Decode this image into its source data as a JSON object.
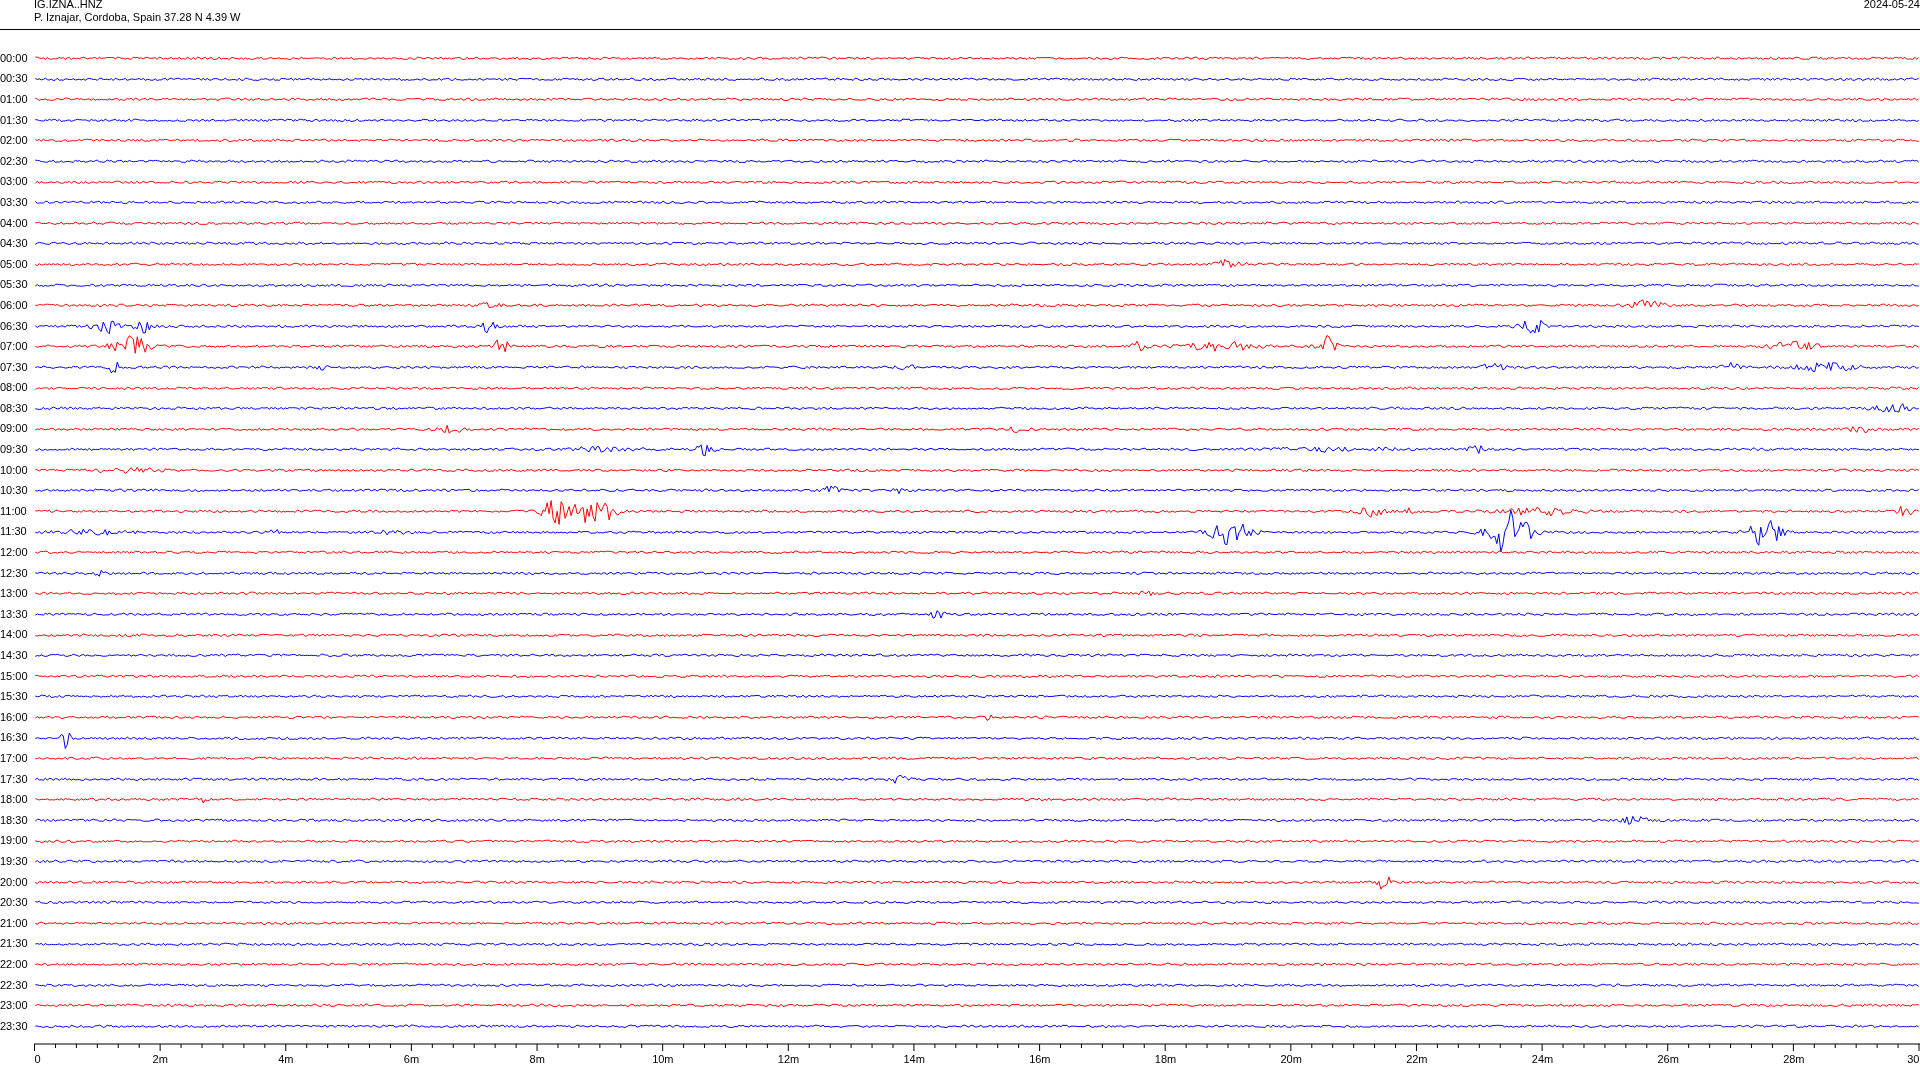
{
  "header": {
    "station": "IG.IZNA..HNZ",
    "location": "P. Iznajar, Cordoba, Spain  37.28 N 4.39 W",
    "date": "2024-05-24"
  },
  "traces": [
    {
      "label": "00:00",
      "color": "#ff0000"
    },
    {
      "label": "00:30",
      "color": "#0000ff"
    },
    {
      "label": "01:00",
      "color": "#ff0000"
    },
    {
      "label": "01:30",
      "color": "#0000ff"
    },
    {
      "label": "02:00",
      "color": "#ff0000"
    },
    {
      "label": "02:30",
      "color": "#0000ff"
    },
    {
      "label": "03:00",
      "color": "#ff0000"
    },
    {
      "label": "03:30",
      "color": "#0000ff"
    },
    {
      "label": "04:00",
      "color": "#ff0000"
    },
    {
      "label": "04:30",
      "color": "#0000ff"
    },
    {
      "label": "05:00",
      "color": "#ff0000"
    },
    {
      "label": "05:30",
      "color": "#0000ff"
    },
    {
      "label": "06:00",
      "color": "#ff0000"
    },
    {
      "label": "06:30",
      "color": "#0000ff"
    },
    {
      "label": "07:00",
      "color": "#ff0000"
    },
    {
      "label": "07:30",
      "color": "#0000ff"
    },
    {
      "label": "08:00",
      "color": "#ff0000"
    },
    {
      "label": "08:30",
      "color": "#0000ff"
    },
    {
      "label": "09:00",
      "color": "#ff0000"
    },
    {
      "label": "09:30",
      "color": "#0000ff"
    },
    {
      "label": "10:00",
      "color": "#ff0000"
    },
    {
      "label": "10:30",
      "color": "#0000ff"
    },
    {
      "label": "11:00",
      "color": "#ff0000"
    },
    {
      "label": "11:30",
      "color": "#0000ff"
    },
    {
      "label": "12:00",
      "color": "#ff0000"
    },
    {
      "label": "12:30",
      "color": "#0000ff"
    },
    {
      "label": "13:00",
      "color": "#ff0000"
    },
    {
      "label": "13:30",
      "color": "#0000ff"
    },
    {
      "label": "14:00",
      "color": "#ff0000"
    },
    {
      "label": "14:30",
      "color": "#0000ff"
    },
    {
      "label": "15:00",
      "color": "#ff0000"
    },
    {
      "label": "15:30",
      "color": "#0000ff"
    },
    {
      "label": "16:00",
      "color": "#ff0000"
    },
    {
      "label": "16:30",
      "color": "#0000ff"
    },
    {
      "label": "17:00",
      "color": "#ff0000"
    },
    {
      "label": "17:30",
      "color": "#0000ff"
    },
    {
      "label": "18:00",
      "color": "#ff0000"
    },
    {
      "label": "18:30",
      "color": "#0000ff"
    },
    {
      "label": "19:00",
      "color": "#ff0000"
    },
    {
      "label": "19:30",
      "color": "#0000ff"
    },
    {
      "label": "20:00",
      "color": "#ff0000"
    },
    {
      "label": "20:30",
      "color": "#0000ff"
    },
    {
      "label": "21:00",
      "color": "#ff0000"
    },
    {
      "label": "21:30",
      "color": "#0000ff"
    },
    {
      "label": "22:00",
      "color": "#ff0000"
    },
    {
      "label": "22:30",
      "color": "#0000ff"
    },
    {
      "label": "23:00",
      "color": "#ff0000"
    },
    {
      "label": "23:30",
      "color": "#0000ff"
    }
  ],
  "time_axis": {
    "labels": [
      "0",
      "2m",
      "4m",
      "6m",
      "8m",
      "10m",
      "12m",
      "14m",
      "16m",
      "18m",
      "20m",
      "22m",
      "24m",
      "26m",
      "28m",
      "30"
    ]
  }
}
